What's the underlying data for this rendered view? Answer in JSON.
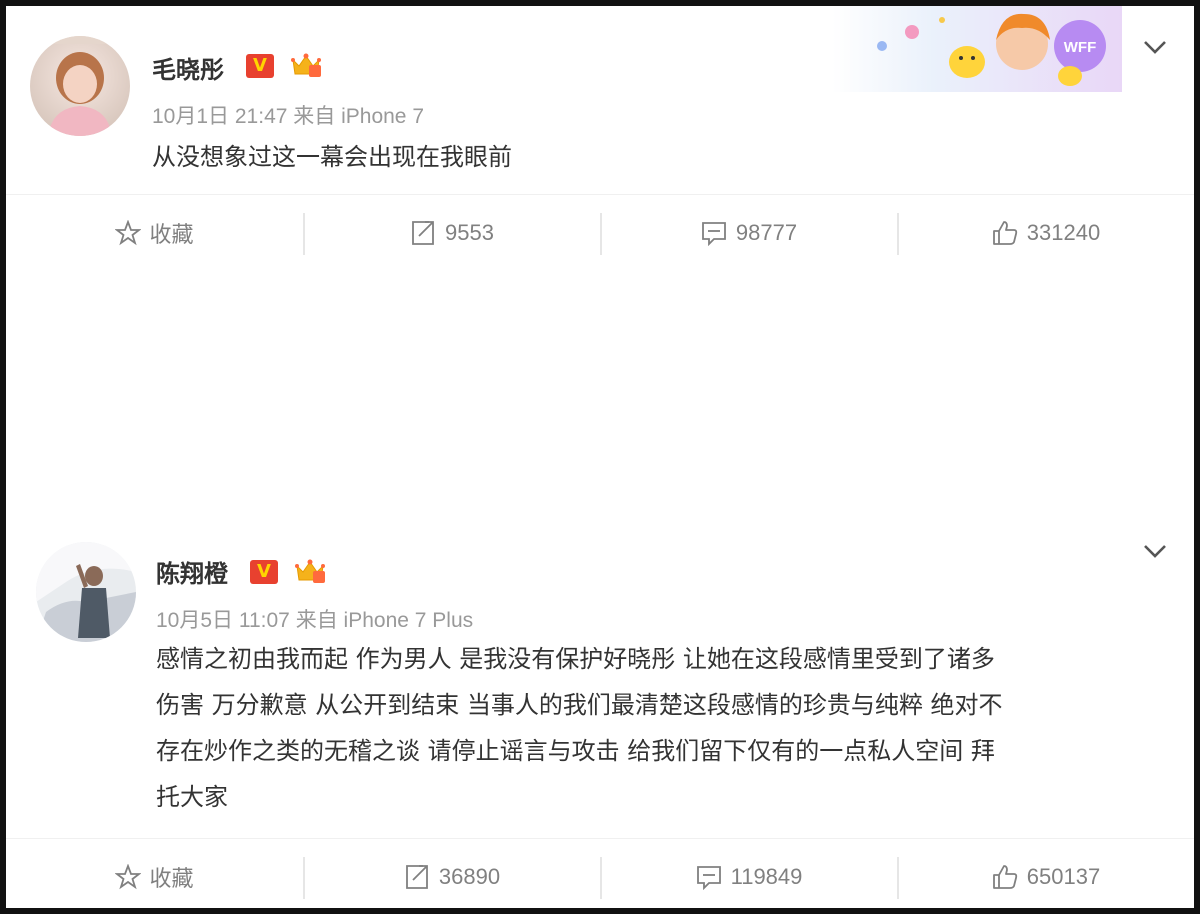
{
  "posts": [
    {
      "user_name": "毛晓彤",
      "verified_badge": "V",
      "meta": "10月1日 21:47 来自 iPhone 7",
      "text": "从没想象过这一幕会出现在我眼前",
      "actions": {
        "favorite_label": "收藏",
        "repost_count": "9553",
        "comment_count": "98777",
        "like_count": "331240"
      }
    },
    {
      "user_name": "陈翔橙",
      "verified_badge": "V",
      "meta": "10月5日 11:07 来自 iPhone 7 Plus",
      "text_lines": [
        "感情之初由我而起 作为男人 是我没有保护好晓彤 让她在这段感情里受到了诸多",
        "伤害 万分歉意 从公开到结束 当事人的我们最清楚这段感情的珍贵与纯粹 绝对不",
        "存在炒作之类的无稽之谈 请停止谣言与攻击 给我们留下仅有的一点私人空间 拜",
        "托大家"
      ],
      "actions": {
        "favorite_label": "收藏",
        "repost_count": "36890",
        "comment_count": "119849",
        "like_count": "650137"
      }
    }
  ],
  "banner_label": "WFF",
  "colors": {
    "verified_red": "#e8412f",
    "verified_gold": "#ffd500",
    "meta_gray": "#999999",
    "action_gray": "#808080"
  },
  "icons": [
    "star-icon",
    "repost-icon",
    "comment-icon",
    "thumbs-up-icon",
    "chevron-down-icon",
    "crown-icon"
  ]
}
